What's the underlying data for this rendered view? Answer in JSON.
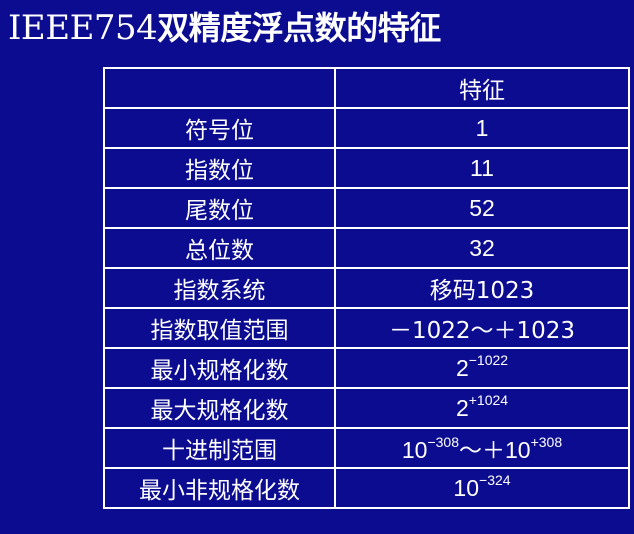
{
  "slide": {
    "title_latin": "IEEE754",
    "title_rest": "双精度浮点数的特征"
  },
  "table": {
    "header": {
      "label": "",
      "value": "特征"
    },
    "rows": [
      {
        "label": "符号位",
        "value": "1"
      },
      {
        "label": "指数位",
        "value": "11"
      },
      {
        "label": "尾数位",
        "value": "52"
      },
      {
        "label": "总位数",
        "value": "32"
      },
      {
        "label": "指数系统",
        "value": "移码1023"
      },
      {
        "label": "指数取值范围",
        "value": "－1022～＋1023"
      },
      {
        "label": "最小规格化数",
        "base": "2",
        "exp": "−1022"
      },
      {
        "label": "最大规格化数",
        "base": "2",
        "exp": "+1024"
      },
      {
        "label": "十进制范围",
        "base": "10",
        "exp": "−308",
        "mid": "～＋10",
        "exp2": "+308"
      },
      {
        "label": "最小非规格化数",
        "base": "10",
        "exp": "−324"
      }
    ]
  }
}
